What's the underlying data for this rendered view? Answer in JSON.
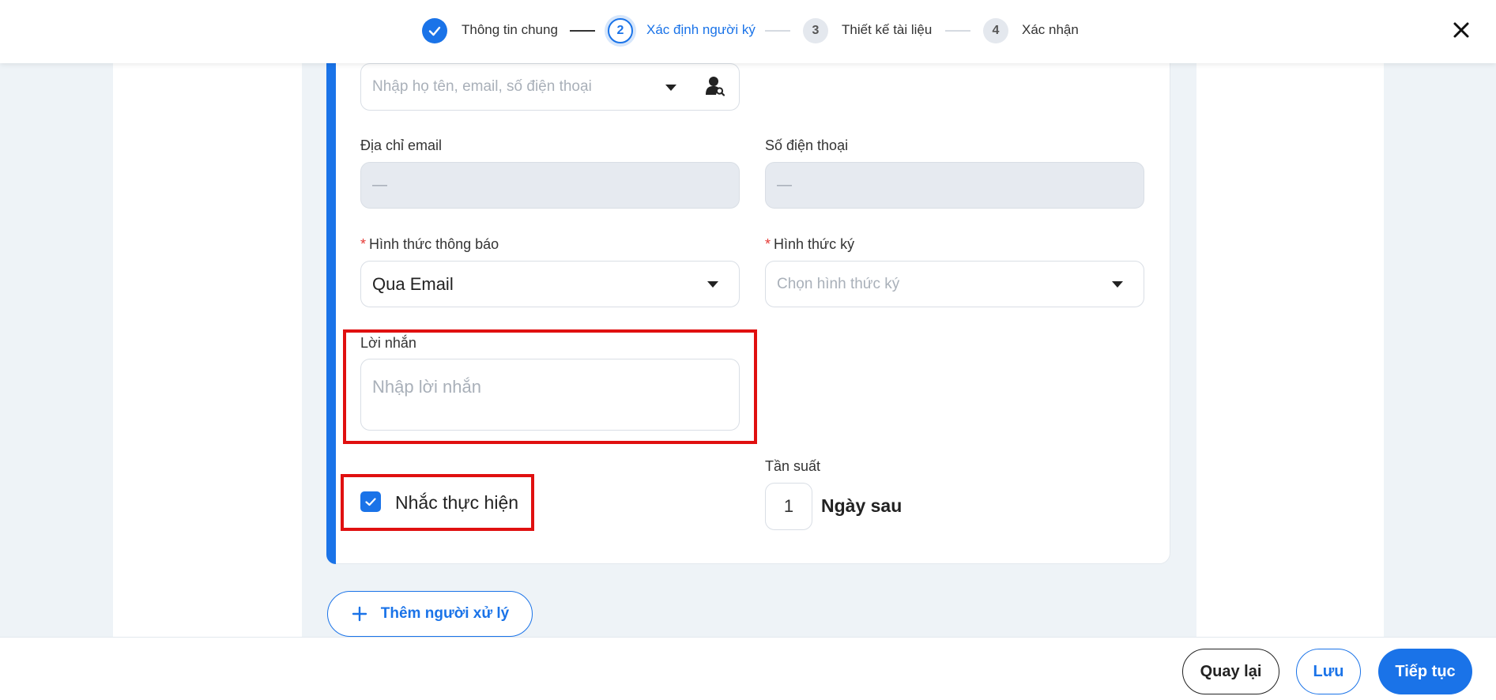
{
  "stepper": {
    "steps": [
      {
        "number": "",
        "label": "Thông tin chung",
        "state": "done"
      },
      {
        "number": "2",
        "label": "Xác định người ký",
        "state": "active"
      },
      {
        "number": "3",
        "label": "Thiết kế tài liệu",
        "state": "pending"
      },
      {
        "number": "4",
        "label": "Xác nhận",
        "state": "pending"
      }
    ]
  },
  "form": {
    "recipient_search": {
      "placeholder": "Nhập họ tên, email, số điện thoại"
    },
    "email": {
      "label": "Địa chỉ email",
      "value": "—"
    },
    "phone": {
      "label": "Số điện thoại",
      "value": "—"
    },
    "notify_method": {
      "required_mark": "*",
      "label": "Hình thức thông báo",
      "value": "Qua Email"
    },
    "sign_method": {
      "required_mark": "*",
      "label": "Hình thức ký",
      "placeholder": "Chọn hình thức ký"
    },
    "message": {
      "label": "Lời nhắn",
      "placeholder": "Nhập lời nhắn"
    },
    "reminder": {
      "label": "Nhắc thực hiện",
      "checked": true
    },
    "frequency": {
      "label": "Tần suất",
      "value": "1",
      "unit": "Ngày sau"
    }
  },
  "add_handler_button": {
    "label": "Thêm người xử lý"
  },
  "footer": {
    "back_label": "Quay lại",
    "save_label": "Lưu",
    "continue_label": "Tiếp tục"
  },
  "colors": {
    "primary": "#1a73e8",
    "highlight": "#e01010",
    "required": "#e53935"
  }
}
